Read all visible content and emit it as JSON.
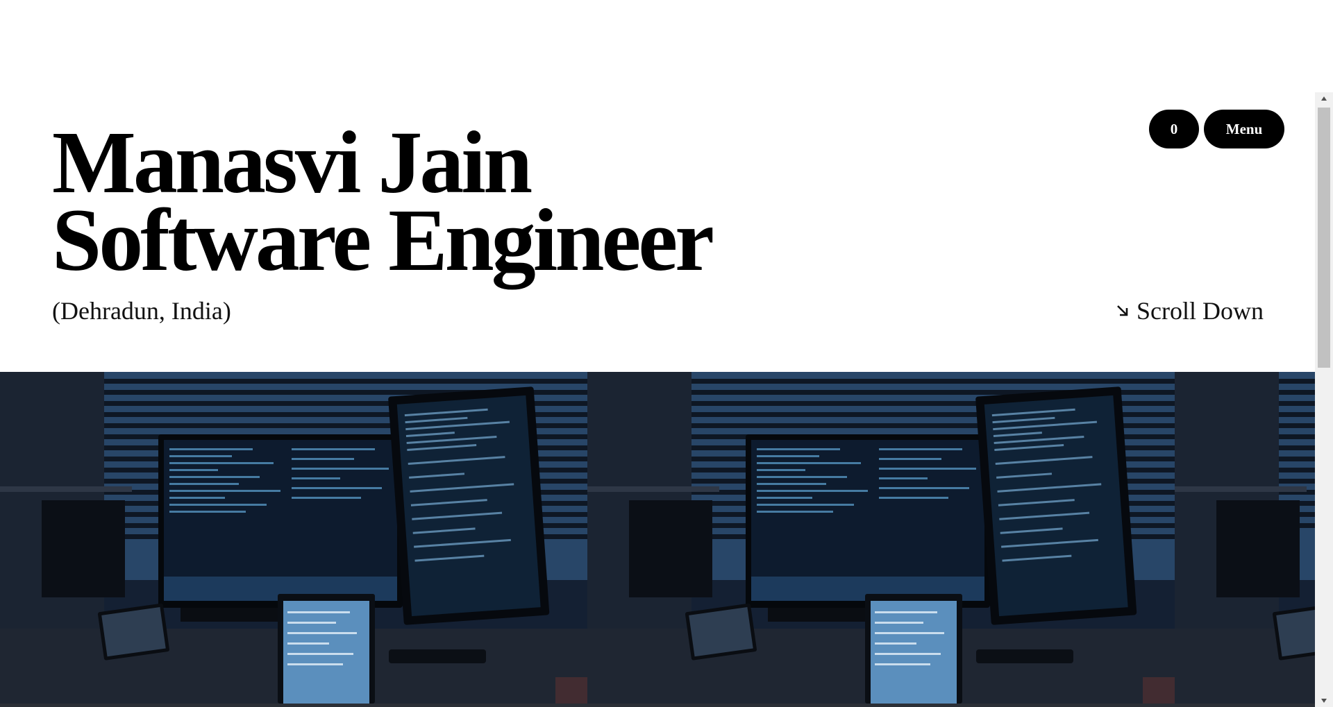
{
  "header": {
    "name": "Manasvi Jain",
    "role": "Software Engineer",
    "location": "(Dehradun, India)"
  },
  "nav": {
    "count_label": "0",
    "menu_label": "Menu"
  },
  "scroll_hint": {
    "label": "Scroll Down",
    "icon": "arrow-down-right-icon"
  },
  "hero_images": [
    {
      "subject": "developer desk with monitors showing code"
    },
    {
      "subject": "developer desk with monitors showing code"
    },
    {
      "subject": "developer desk with monitors showing code"
    }
  ],
  "colors": {
    "background": "#ffffff",
    "text": "#000000",
    "pill_bg": "#000000",
    "pill_text": "#ffffff",
    "scrollbar_track": "#f1f1f1",
    "scrollbar_thumb": "#c1c1c1"
  }
}
